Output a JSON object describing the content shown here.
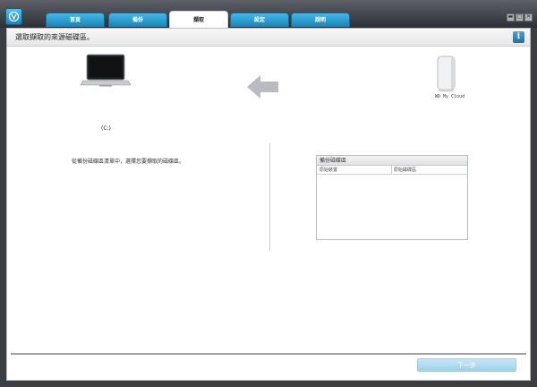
{
  "tabs": [
    {
      "label": "首頁"
    },
    {
      "label": "備份"
    },
    {
      "label": "擷取"
    },
    {
      "label": "設定"
    },
    {
      "label": "說明"
    }
  ],
  "window_buttons": {
    "minimize": "▬",
    "maximize": "▢",
    "close": "✕"
  },
  "header": {
    "title": "選取擷取的來源磁碟區。",
    "info_icon": "i"
  },
  "source": {
    "drive_label": "(C:)"
  },
  "target": {
    "device_label": "WD My Cloud"
  },
  "instruction": "從備份磁碟區清單中，選擇您要擷取的磁碟區。",
  "volume_panel": {
    "title": "備份磁碟區",
    "columns": [
      "原始裝置",
      "原始磁碟區"
    ]
  },
  "footer": {
    "next_label": "下一步"
  },
  "colors": {
    "tab_blue": "#1e8bc3",
    "accent": "#4fc3ea",
    "next_button": "#9dd1ec"
  }
}
